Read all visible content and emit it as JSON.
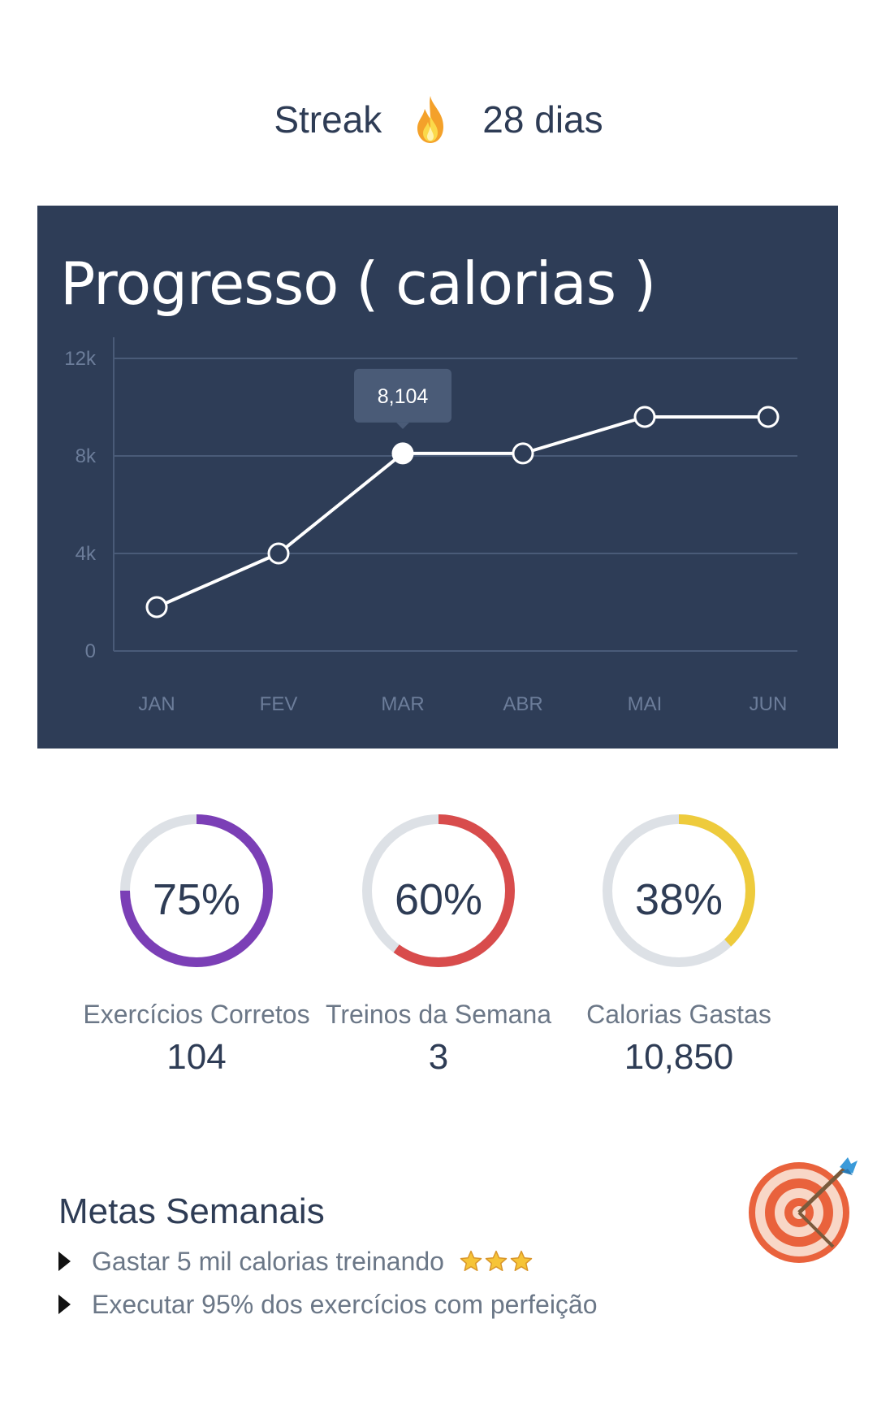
{
  "streak": {
    "label": "Streak",
    "icon": "flame-icon",
    "value": "28 dias"
  },
  "chart_card": {
    "background": "#2e3d57",
    "line_color": "#ffffff"
  },
  "chart_data": {
    "type": "line",
    "title": "Progresso ( calorias )",
    "categories": [
      "JAN",
      "FEV",
      "MAR",
      "ABR",
      "MAI",
      "JUN"
    ],
    "series": [
      {
        "values": [
          1800,
          4000,
          8104,
          8104,
          9600,
          9600
        ]
      }
    ],
    "ylim": [
      0,
      12000
    ],
    "yticks": [
      0,
      4000,
      8000,
      12000
    ],
    "ytick_labels": [
      "0",
      "4k",
      "8k",
      "12k"
    ],
    "grid": true,
    "highlight": {
      "index": 2,
      "label": "8,104"
    }
  },
  "stats": [
    {
      "percent": "75%",
      "fraction": 0.75,
      "color": "#7b3fb6",
      "label": "Exercícios Corretos",
      "value": "104"
    },
    {
      "percent": "60%",
      "fraction": 0.6,
      "color": "#d84c4c",
      "label": "Treinos da Semana",
      "value": "3"
    },
    {
      "percent": "38%",
      "fraction": 0.38,
      "color": "#eecb3c",
      "label": "Calorias Gastas",
      "value": "10,850"
    }
  ],
  "ring_track_color": "#dde1e6",
  "goals": {
    "title": "Metas Semanais",
    "icon": "target-icon",
    "items": [
      {
        "text": "Gastar 5 mil calorias treinando",
        "stars": 3
      },
      {
        "text": "Executar 95% dos exercícios com perfeição",
        "stars": 0
      }
    ]
  }
}
